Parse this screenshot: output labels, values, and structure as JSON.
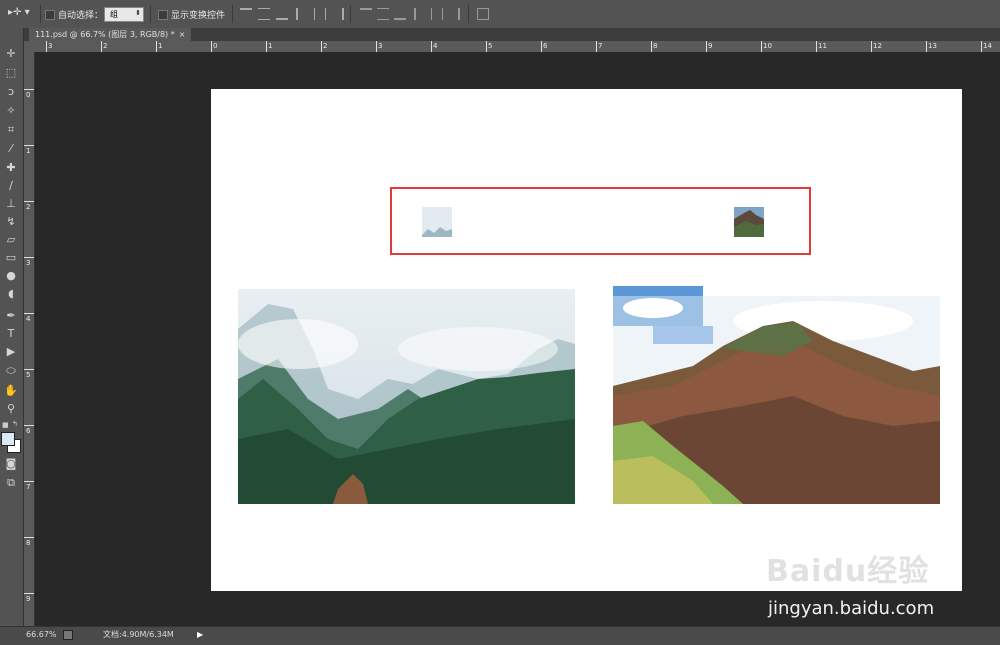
{
  "options_bar": {
    "auto_select_label": "自动选择：",
    "auto_select_value": "组",
    "show_transform_label": "显示变换控件"
  },
  "document_tab": {
    "title": "111.psd @ 66.7% (图层 3, RGB/8) *",
    "close": "×"
  },
  "rulers": {
    "h_labels": [
      "0",
      "1",
      "2",
      "3",
      "4",
      "5",
      "6",
      "7",
      "8",
      "9",
      "10",
      "11",
      "12",
      "13",
      "14"
    ],
    "v_labels": [
      "0",
      "1",
      "2",
      "3",
      "4",
      "5",
      "6",
      "7",
      "8",
      "9"
    ],
    "h_neg_labels": [
      "3",
      "2",
      "1"
    ]
  },
  "status_bar": {
    "zoom": "66.67%",
    "doc_size": "文档:4.90M/6.34M"
  },
  "watermark": {
    "logo_text": "Baidu经验",
    "url": "jingyan.baidu.com"
  },
  "colors": {
    "selection_border": "#e33a3a",
    "panel_bg": "#535353",
    "canvas_bg": "#282828"
  }
}
